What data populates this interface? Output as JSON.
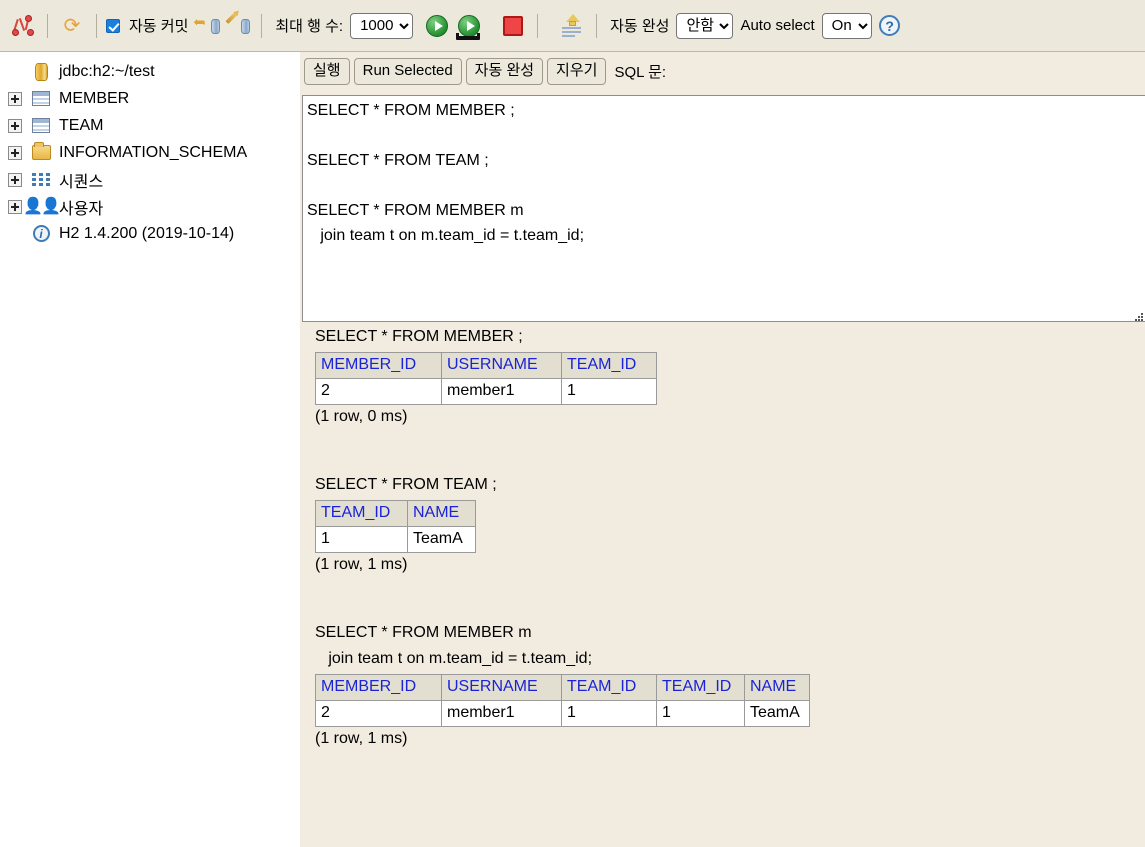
{
  "toolbar": {
    "disconnect_icon": "disconnect-icon",
    "refresh_icon": "refresh-icon",
    "autocommit_label": "자동 커밋",
    "commit_icon": "commit-icon",
    "rollback_icon": "rollback-icon",
    "max_rows_label": "최대 행 수:",
    "max_rows_value": "1000",
    "max_rows_options": [
      "1000"
    ],
    "run_icon": "run-icon",
    "run_selected_icon": "run-selected-icon",
    "stop_icon": "stop-icon",
    "autocomplete_icon": "autocomplete-icon",
    "autocomplete_label": "자동 완성",
    "autocomplete_value": "안함",
    "autocomplete_options": [
      "안함"
    ],
    "auto_select_label": "Auto select",
    "auto_select_value": "On",
    "auto_select_options": [
      "On"
    ],
    "help_icon": "help-icon"
  },
  "sidebar": {
    "items": [
      {
        "label": "jdbc:h2:~/test",
        "icon": "database-icon",
        "expandable": false
      },
      {
        "label": "MEMBER",
        "icon": "table-icon",
        "expandable": true
      },
      {
        "label": "TEAM",
        "icon": "table-icon",
        "expandable": true
      },
      {
        "label": "INFORMATION_SCHEMA",
        "icon": "folder-icon",
        "expandable": true
      },
      {
        "label": "시퀀스",
        "icon": "sequence-icon",
        "expandable": true
      },
      {
        "label": "사용자",
        "icon": "users-icon",
        "expandable": true
      },
      {
        "label": "H2 1.4.200 (2019-10-14)",
        "icon": "info-icon",
        "expandable": false
      }
    ]
  },
  "sql_panel": {
    "run_label": "실행",
    "run_selected_label": "Run Selected",
    "autocomplete_label": "자동 완성",
    "clear_label": "지우기",
    "caption": "SQL 문:",
    "editor_value": "SELECT * FROM MEMBER ;\n\nSELECT * FROM TEAM ;\n\nSELECT * FROM MEMBER m\n   join team t on m.team_id = t.team_id;"
  },
  "results": [
    {
      "query": "SELECT * FROM MEMBER ;",
      "columns": [
        "MEMBER_ID",
        "USERNAME",
        "TEAM_ID"
      ],
      "rows": [
        [
          "2",
          "member1",
          "1"
        ]
      ],
      "status": "(1 row, 0 ms)"
    },
    {
      "query": "SELECT * FROM TEAM ;",
      "columns": [
        "TEAM_ID",
        "NAME"
      ],
      "rows": [
        [
          "1",
          "TeamA"
        ]
      ],
      "status": "(1 row, 1 ms)"
    },
    {
      "query": "SELECT * FROM MEMBER m\n   join team t on m.team_id = t.team_id;",
      "columns": [
        "MEMBER_ID",
        "USERNAME",
        "TEAM_ID",
        "TEAM_ID",
        "NAME"
      ],
      "rows": [
        [
          "2",
          "member1",
          "1",
          "1",
          "TeamA"
        ]
      ],
      "status": "(1 row, 1 ms)"
    }
  ],
  "colors": {
    "toolbar_bg": "#ece9dc",
    "panel_bg": "#f2ece0",
    "header_text": "#1a23d8",
    "accent_green": "#1f8a2e",
    "accent_red": "#ee4646",
    "accent_blue": "#3f7cb8"
  }
}
